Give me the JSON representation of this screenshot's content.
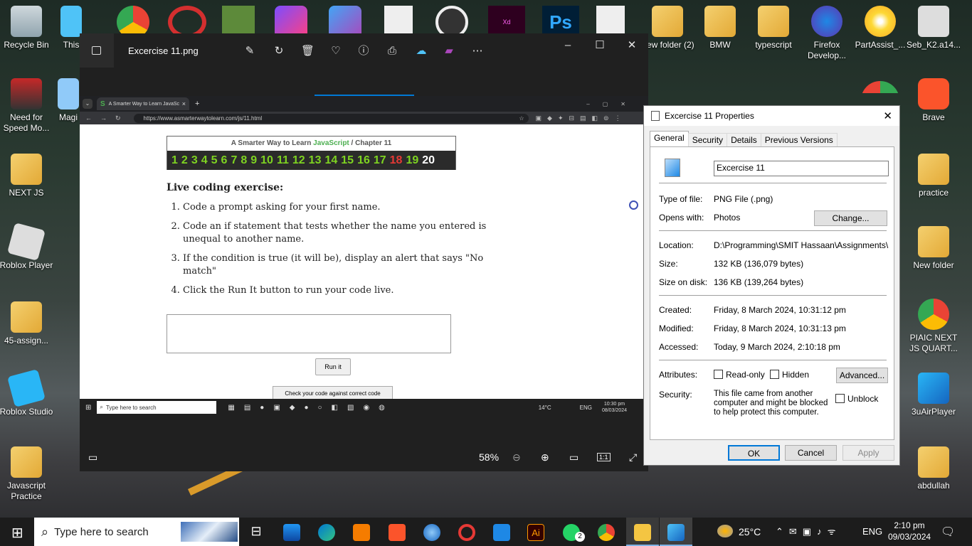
{
  "desktop_icons_left": [
    {
      "label": "Recycle Bin",
      "icon": "recycle-bin-icon"
    },
    {
      "label": "Need for Speed Mo...",
      "icon": "game-icon"
    },
    {
      "label": "NEXT JS",
      "icon": "folder-icon"
    },
    {
      "label": "Roblox Player",
      "icon": "roblox-icon"
    },
    {
      "label": "45-assign...",
      "icon": "folder-icon"
    },
    {
      "label": "Roblox Studio",
      "icon": "roblox-studio-icon"
    },
    {
      "label": "Javascript Practice",
      "icon": "folder-icon"
    }
  ],
  "desktop_icons_partial": [
    {
      "label": "This"
    },
    {
      "label": "Magi"
    }
  ],
  "desktop_icons_right_top": [
    {
      "label": "New folder (2)"
    },
    {
      "label": "BMW"
    },
    {
      "label": "typescript"
    },
    {
      "label": "Firefox Develop..."
    },
    {
      "label": "PartAssist_..."
    },
    {
      "label": "Seb_K2.a14..."
    }
  ],
  "desktop_icons_right": [
    {
      "label": "Brave"
    },
    {
      "label": "practice"
    },
    {
      "label": "New folder"
    },
    {
      "label": "PIAIC NEXT JS QUART..."
    },
    {
      "label": "3uAirPlayer"
    },
    {
      "label": "abdullah"
    }
  ],
  "photos": {
    "title": "Excercise 11.png",
    "zoom": "58%"
  },
  "browser": {
    "tab_title": "A Smarter Way to Learn JavaSc",
    "url": "https://www.asmarterwaytolearn.com/js/11.html",
    "banner_prefix": "A Smarter Way to Learn ",
    "banner_js": "JavaScript",
    "banner_suffix": " /  Chapter 11",
    "chapters": [
      "1",
      "2",
      "3",
      "4",
      "5",
      "6",
      "7",
      "8",
      "9",
      "10",
      "11",
      "12",
      "13",
      "14",
      "15",
      "16",
      "17",
      "18",
      "19",
      "20"
    ],
    "heading": "Live coding exercise:",
    "steps": [
      "Code a prompt asking for your first name.",
      "Code an if statement that tests whether the name you entered is unequal to another name.",
      "If the condition is true (it will be), display an alert that says \"No match\"",
      "Click the Run It button to run your code live."
    ],
    "run_button": "Run it",
    "check_button": "Check your code against correct code",
    "mini_search": "Type here to search",
    "mini_temp": "14°C",
    "mini_lang": "ENG",
    "mini_time": "10:30 pm",
    "mini_date": "08/03/2024"
  },
  "props": {
    "title": "Excercise 11 Properties",
    "tabs": [
      "General",
      "Security",
      "Details",
      "Previous Versions"
    ],
    "filename": "Excercise 11",
    "type_label": "Type of file:",
    "type_value": "PNG File (.png)",
    "opens_label": "Opens with:",
    "opens_value": "Photos",
    "change_btn": "Change...",
    "location_label": "Location:",
    "location_value": "D:\\Programming\\SMIT Hassaan\\Assignments\\Exce",
    "size_label": "Size:",
    "size_value": "132 KB (136,079 bytes)",
    "sizedisk_label": "Size on disk:",
    "sizedisk_value": "136 KB (139,264 bytes)",
    "created_label": "Created:",
    "created_value": "Friday, 8 March 2024, 10:31:12 pm",
    "modified_label": "Modified:",
    "modified_value": "Friday, 8 March 2024, 10:31:13 pm",
    "accessed_label": "Accessed:",
    "accessed_value": "Today, 9 March 2024, 2:10:18 pm",
    "attributes_label": "Attributes:",
    "readonly": "Read-only",
    "hidden": "Hidden",
    "advanced_btn": "Advanced...",
    "security_label": "Security:",
    "security_text": "This file came from another computer and might be blocked to help protect this computer.",
    "unblock": "Unblock",
    "ok": "OK",
    "cancel": "Cancel",
    "apply": "Apply"
  },
  "taskbar": {
    "search_placeholder": "Type here to search",
    "temp": "25°C",
    "lang": "ENG",
    "time": "2:10 pm",
    "date": "09/03/2024",
    "whatsapp_badge": "2"
  }
}
